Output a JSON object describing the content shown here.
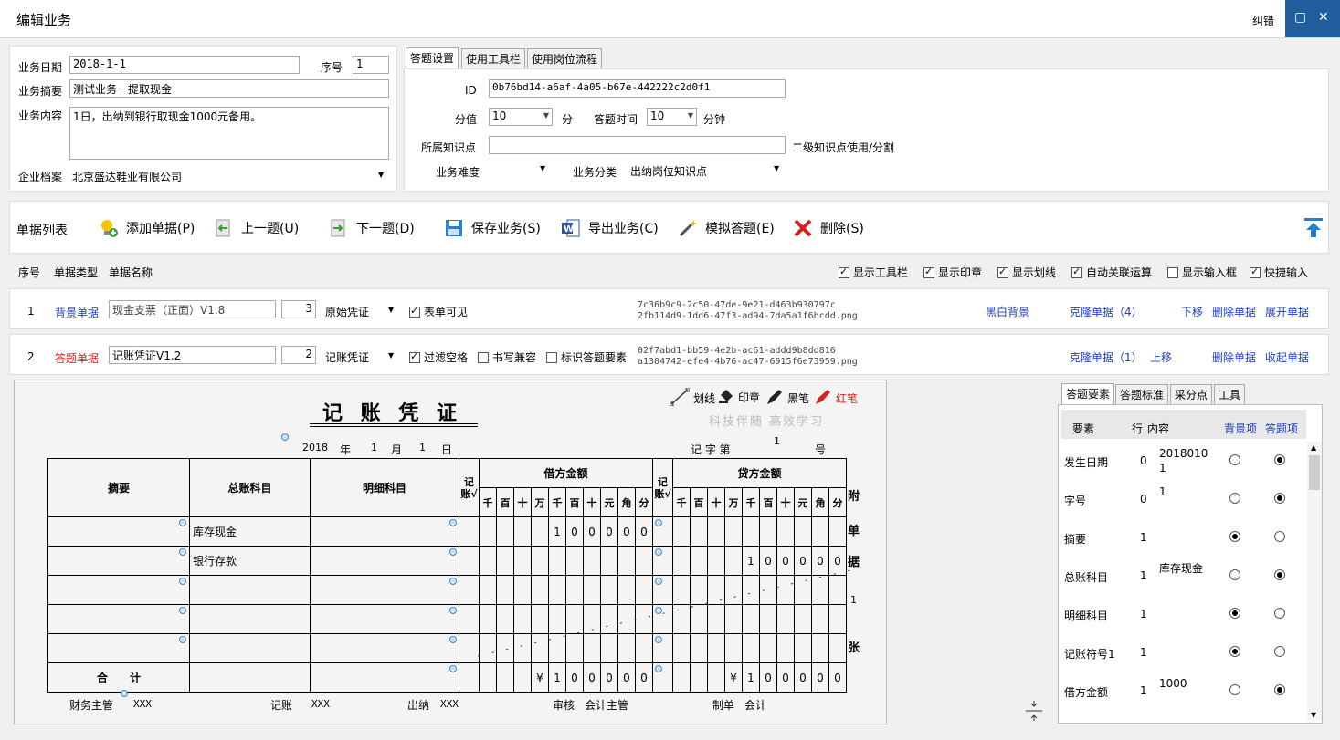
{
  "window": {
    "title": "编辑业务",
    "jiucuo": "纠错",
    "max_icon": "▢",
    "close_icon": "✕"
  },
  "form": {
    "date_label": "业务日期",
    "date_value": "2018-1-1",
    "seq_label": "序号",
    "seq_value": "1",
    "summary_label": "业务摘要",
    "summary_value": "测试业务一提取现金",
    "content_label": "业务内容",
    "content_value": "1日，出纳到银行取现金1000元备用。",
    "company_label": "企业档案",
    "company_value": "北京盛达鞋业有限公司"
  },
  "tabs": [
    "答题设置",
    "使用工具栏",
    "使用岗位流程"
  ],
  "settings": {
    "id_label": "ID",
    "id_value": "0b76bd14-a6af-4a05-b67e-442222c2d0f1",
    "score_label": "分值",
    "score_value": "10",
    "score_unit": "分",
    "time_label": "答题时间",
    "time_value": "10",
    "time_unit": "分钟",
    "knowledge_label": "所属知识点",
    "knowledge_hint": "二级知识点使用/分割",
    "difficulty_label": "业务难度",
    "category_label": "业务分类",
    "category_value": "出纳岗位知识点"
  },
  "toolbar": {
    "list_label": "单据列表",
    "add": "添加单据(P)",
    "prev": "上一题(U)",
    "next": "下一题(D)",
    "save": "保存业务(S)",
    "export": "导出业务(C)",
    "simulate": "模拟答题(E)",
    "delete": "删除(S)"
  },
  "headers": {
    "seq": "序号",
    "type": "单据类型",
    "name": "单据名称"
  },
  "options": [
    {
      "label": "显示工具栏",
      "on": true
    },
    {
      "label": "显示印章",
      "on": true
    },
    {
      "label": "显示划线",
      "on": true
    },
    {
      "label": "自动关联运算",
      "on": true
    },
    {
      "label": "显示输入框",
      "on": false
    },
    {
      "label": "快捷输入",
      "on": true
    }
  ],
  "row1": {
    "seq": "1",
    "type": "背景单据",
    "name": "现金支票（正面）V1.8",
    "num": "3",
    "vtype": "原始凭证",
    "visible": "表单可见",
    "hash1": "7c36b9c9-2c50-47de-9e21-d463b930797c",
    "hash2": "2fb114d9-1dd6-47f3-ad94-7da5a1f6bcdd.png",
    "bg": "黑白背景",
    "clone": "克隆单据（4）",
    "down": "下移",
    "del": "删除单据",
    "expand": "展开单据"
  },
  "row2": {
    "seq": "2",
    "type": "答题单据",
    "name": "记账凭证V1.2",
    "num": "2",
    "vtype": "记账凭证",
    "filter": "过滤空格",
    "writing": "书写兼容",
    "mark": "标识答题要素",
    "hash1": "02f7abd1-bb59-4e2b-ac61-addd9b8dd816",
    "hash2": "a1304742-efe4-4b76-ac47-6915f6e73959.png",
    "clone": "克隆单据（1）",
    "up": "上移",
    "del": "删除单据",
    "collapse": "收起单据"
  },
  "voucher": {
    "title": "记 账 凭 证",
    "line": "划线",
    "stamp": "印章",
    "black": "黑笔",
    "red": "红笔",
    "slogan": "科技伴随 高效学习",
    "year": "2018",
    "year_u": "年",
    "month": "1",
    "month_u": "月",
    "day": "1",
    "day_u": "日",
    "no_label": "记 字 第",
    "no_value": "1",
    "no_unit": "号",
    "col_summary": "摘要",
    "col_general": "总账科目",
    "col_detail": "明细科目",
    "col_check": "记账√",
    "col_debit": "借方金额",
    "col_credit": "贷方金额",
    "digits": [
      "千",
      "百",
      "十",
      "万",
      "千",
      "百",
      "十",
      "元",
      "角",
      "分"
    ],
    "attach": [
      "附",
      "单",
      "据",
      "1",
      "张"
    ],
    "row1_general": "库存现金",
    "row2_general": "银行存款",
    "debit1": [
      "",
      "",
      "",
      "",
      "1",
      "0",
      "0",
      "0",
      "0",
      "0"
    ],
    "credit2": [
      "",
      "",
      "",
      "",
      "1",
      "0",
      "0",
      "0",
      "0",
      "0"
    ],
    "total_label": "合　　计",
    "total_debit": [
      "",
      "",
      "",
      "¥",
      "1",
      "0",
      "0",
      "0",
      "0",
      "0"
    ],
    "total_credit": [
      "",
      "",
      "",
      "¥",
      "1",
      "0",
      "0",
      "0",
      "0",
      "0"
    ],
    "sign_finance": "财务主管",
    "sign_finance_v": "XXX",
    "sign_book": "记账",
    "sign_book_v": "XXX",
    "sign_cash": "出纳",
    "sign_cash_v": "XXX",
    "sign_review": "审核",
    "sign_review_v": "会计主管",
    "sign_make": "制单",
    "sign_make_v": "会计"
  },
  "rtabs": [
    "答题要素",
    "答题标准",
    "采分点",
    "工具"
  ],
  "rhead": {
    "elem": "要素",
    "row": "行",
    "content": "内容",
    "bg": "背景项",
    "ans": "答题项"
  },
  "relems": [
    {
      "n": "发生日期",
      "r": "0",
      "c": "2018010\n1",
      "bg": false
    },
    {
      "n": "字号",
      "r": "0",
      "c": "1",
      "bg": false
    },
    {
      "n": "摘要",
      "r": "1",
      "c": "",
      "bg": true
    },
    {
      "n": "总账科目",
      "r": "1",
      "c": "库存现金",
      "bg": false
    },
    {
      "n": "明细科目",
      "r": "1",
      "c": "",
      "bg": true
    },
    {
      "n": "记账符号1",
      "r": "1",
      "c": "",
      "bg": true
    },
    {
      "n": "借方金额",
      "r": "1",
      "c": "1000",
      "bg": false
    }
  ]
}
